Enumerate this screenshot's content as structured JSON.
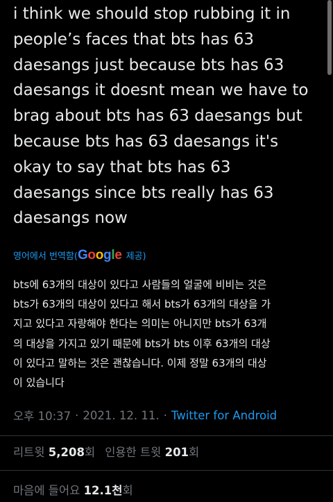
{
  "tweet": {
    "text_lines": [
      "i think we should stop rubbing it in",
      "people’s faces that bts has 63",
      "daesangs just because bts has 63",
      "daesangs it doesnt mean we have to",
      "brag about bts has 63 daesangs but",
      "because bts has 63 daesangs it's",
      "okay to say that bts has 63",
      "daesangs since bts really has 63",
      "daesangs now"
    ]
  },
  "translation": {
    "prefix": "영어에서 번역함(",
    "google_letters": [
      "G",
      "o",
      "o",
      "g",
      "l",
      "e"
    ],
    "suffix": "제공)",
    "lines": [
      "bts에 63개의 대상이 있다고 사람들의 얼굴에 비비는 것은",
      "bts가 63개의 대상이 있다고 해서 bts가 63개의 대상을 가",
      "지고 있다고 자랑해야 한다는 의미는 아니지만 bts가 63개",
      "의 대상을 가지고 있기 때문에 bts가 bts 이후 63개의 대상",
      "이 있다고 말하는 것은 괜찮습니다. 이제 정말 63개의 대상",
      "이 있습니다"
    ]
  },
  "meta": {
    "time": "오후 10:37",
    "separator": "·",
    "date": "2021. 12. 11.",
    "source": "Twitter for Android"
  },
  "stats": {
    "retweets_label": "리트윗",
    "retweets_count": "5,208",
    "retweets_unit": "회",
    "quotes_label": "인용한 트윗",
    "quotes_count": "201",
    "quotes_unit": "회",
    "likes_label": "마음에 들어요",
    "likes_count": "12.1천",
    "likes_unit": "회"
  },
  "colors": {
    "background": "#000000",
    "text": "#e7e9ea",
    "secondary": "#71767b",
    "link": "#1d9bf0",
    "divider": "#2f3336"
  }
}
